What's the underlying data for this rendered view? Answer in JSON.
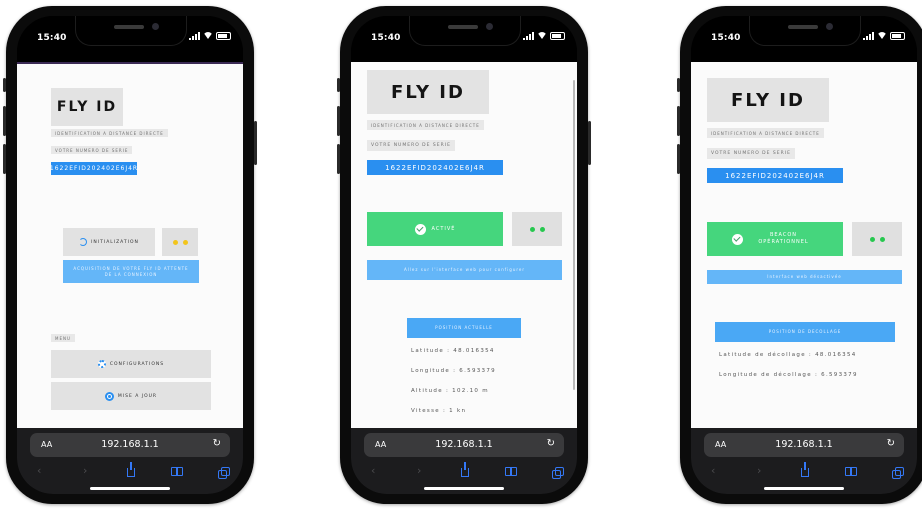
{
  "status": {
    "time": "15:40"
  },
  "browser": {
    "text_size": "AA",
    "url": "192.168.1.1"
  },
  "phone1": {
    "logo": "FLY ID",
    "subtitle": "IDENTIFICATION A DISTANCE DIRECTE",
    "serial_label": "VOTRE NUMERO DE SERIE",
    "serial_value": "1622EFID202402E6J4R",
    "status_button": "INITIALIZATION",
    "led_color": "#f2c51c",
    "info_button": "ACQUISITION DE VOTRE FLY ID ATTENTE DE LA CONNEXION",
    "menu_label": "MENU",
    "config_button": "CONFIGURATIONS",
    "update_button": "MISE A JOUR"
  },
  "phone2": {
    "logo": "FLY ID",
    "subtitle": "IDENTIFICATION A DISTANCE DIRECTE",
    "serial_label": "VOTRE NUMERO DE SERIE",
    "serial_value": "1622EFID202402E6J4R",
    "status_button": "ACTIVÉ",
    "led_color": "#27c84f",
    "info_button": "Allez sur l'interface web pour configurer",
    "position_button": "POSITION ACTUELLE",
    "latitude": "Latitude : 48.016354",
    "longitude": "Longitude : 6.593379",
    "altitude": "Altitude : 102.10 m",
    "speed": "Vitesse : 1 kn"
  },
  "phone3": {
    "logo": "FLY ID",
    "subtitle": "IDENTIFICATION A DISTANCE DIRECTE",
    "serial_label": "VOTRE NUMERO DE SERIE",
    "serial_value": "1622EFID202402E6J4R",
    "status_button": "BEACON OPÉRATIONNEL",
    "led_color": "#27c84f",
    "info_button": "Interface web désactivée",
    "position_button": "POSITION DE DECOLLAGE",
    "takeoff_latitude": "Latitude de décollage : 48.016354",
    "takeoff_longitude": "Longitude de décollage : 6.593379"
  }
}
